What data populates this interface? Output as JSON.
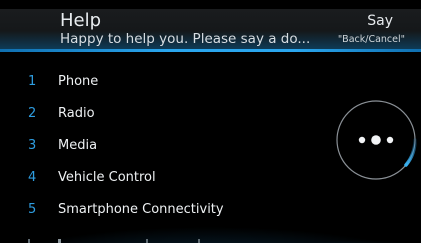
{
  "header": {
    "title": "Help",
    "subtitle": "Happy to help you. Please say a do...",
    "say_label": "Say",
    "say_command": "\"Back/Cancel\""
  },
  "menu": {
    "items": [
      {
        "number": "1",
        "label": "Phone"
      },
      {
        "number": "2",
        "label": "Radio"
      },
      {
        "number": "3",
        "label": "Media"
      },
      {
        "number": "4",
        "label": "Vehicle Control"
      },
      {
        "number": "5",
        "label": "Smartphone Connectivity"
      }
    ]
  },
  "voice_indicator": {
    "icon": "listening-dots-icon"
  },
  "colors": {
    "accent": "#2e9de0",
    "background": "#000000",
    "text": "#eef1f3"
  }
}
